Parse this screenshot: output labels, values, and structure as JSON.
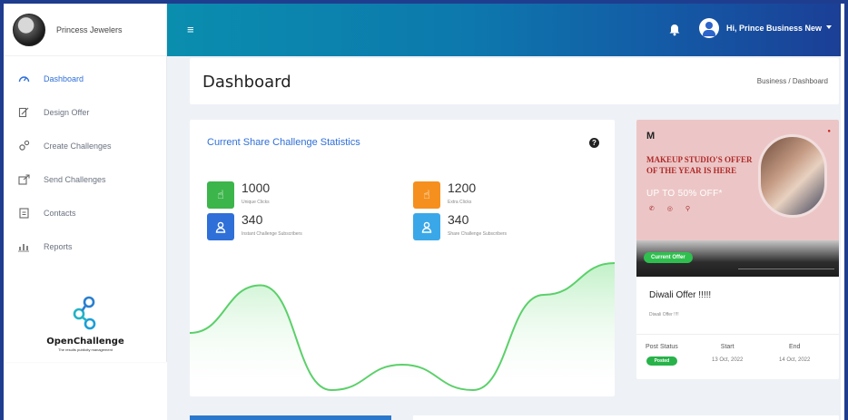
{
  "brand": {
    "name": "Princess Jewelers",
    "logo_name": "OpenChallenge",
    "logo_tagline": "The results publicity management"
  },
  "sidebar": {
    "items": [
      {
        "label": "Dashboard",
        "icon": "gauge-icon",
        "active": true
      },
      {
        "label": "Design Offer",
        "icon": "edit-icon",
        "active": false
      },
      {
        "label": "Create Challenges",
        "icon": "gears-icon",
        "active": false
      },
      {
        "label": "Send Challenges",
        "icon": "share-icon",
        "active": false
      },
      {
        "label": "Contacts",
        "icon": "contacts-icon",
        "active": false
      },
      {
        "label": "Reports",
        "icon": "reports-icon",
        "active": false
      }
    ]
  },
  "header": {
    "menu_icon": "hamburger-icon",
    "bell_icon": "bell-icon",
    "user_greeting": "Hi, Prince Business New"
  },
  "page": {
    "title": "Dashboard",
    "breadcrumb": "Business / Dashboard"
  },
  "stats": {
    "title": "Current Share Challenge Statistics",
    "help_icon": "question-icon",
    "items": [
      {
        "value": "1000",
        "label": "Unique Clicks",
        "color": "#3cb54a",
        "icon": "hand-pointer-icon"
      },
      {
        "value": "1200",
        "label": "Extra Clicks",
        "color": "#f5901e",
        "icon": "hand-pointer-icon"
      },
      {
        "value": "340",
        "label": "Instant Challenge Subscribers",
        "color": "#2f6fd8",
        "icon": "user-icon"
      },
      {
        "value": "340",
        "label": "Share Challenge Subscribers",
        "color": "#3aa8e8",
        "icon": "user-icon"
      }
    ]
  },
  "chart_data": {
    "type": "area",
    "x": [
      0,
      1,
      2,
      3,
      4,
      5,
      6
    ],
    "values": [
      18,
      33,
      0,
      8,
      0,
      30,
      40
    ],
    "color": "#5bd06a",
    "grid": false
  },
  "offer": {
    "banner": {
      "logo": "M",
      "headline": "MAKEUP STUDIO'S OFFER OF THE YEAR IS HERE",
      "subline": "UP TO 50% OFF*",
      "icons": "✆ ◎ ⚲"
    },
    "badge": "Current Offer",
    "title": "Diwali Offer !!!!!",
    "description": "Diwali Offer !!!!",
    "columns": {
      "post_status_label": "Post Status",
      "post_status_value": "Posted",
      "start_label": "Start",
      "start_value": "13 Oct, 2022",
      "end_label": "End",
      "end_value": "14 Oct, 2022"
    }
  }
}
